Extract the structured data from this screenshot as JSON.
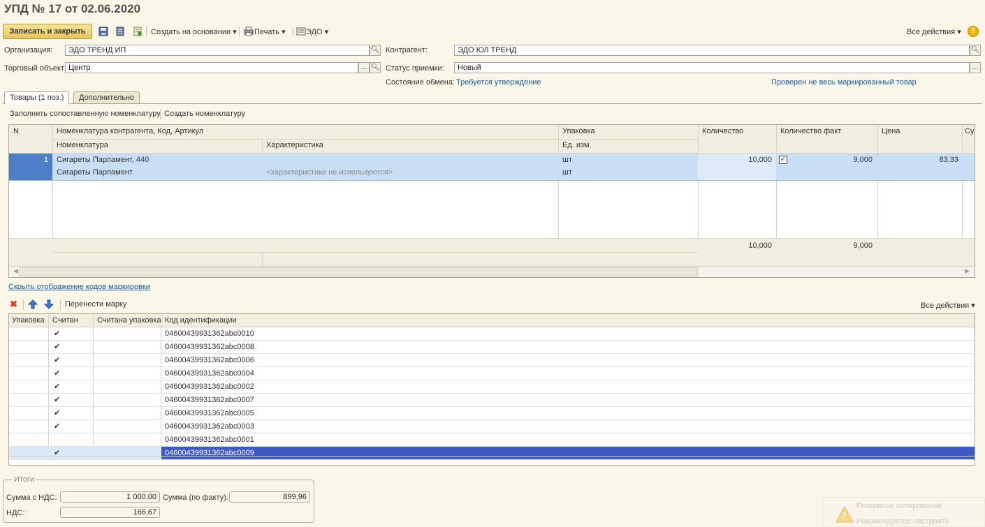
{
  "window": {
    "title": "УПД № 17 от 02.06.2020"
  },
  "toolbar": {
    "save_close_label": "Записать и закрыть",
    "create_based_label": "Создать на основании",
    "print_label": "Печать",
    "edo_label": "ЭДО",
    "all_actions_label": "Все действия",
    "help_label": "?"
  },
  "header": {
    "organization_label": "Организация:",
    "organization_value": "ЭДО ТРЕНД ИП",
    "counterparty_label": "Контрагент:",
    "counterparty_value": "ЭДО ЮЛ ТРЕНД",
    "store_label": "Торговый объект:",
    "store_value": "Центр",
    "accept_status_label": "Статус приемки:",
    "accept_status_value": "Новый",
    "exchange_state_label": "Состояние обмена:",
    "exchange_state_value": "Требуется утверждение",
    "marking_check_link": "Проверен не весь маркированный товар"
  },
  "tabs": [
    {
      "label": "Товары (1 поз.)",
      "active": true
    },
    {
      "label": "Дополнительно",
      "active": false
    }
  ],
  "goods_toolbar": {
    "fill_label": "Заполнить сопоставленную номенклатуру",
    "create_label": "Создать номенклатуру"
  },
  "goods_table": {
    "headers": {
      "n": "N",
      "nomen_counterparty": "Номенклатура контрагента, Код, Артикул",
      "nomen": "Номенклатура",
      "characteristic": "Характеристика",
      "package": "Упаковка",
      "unit": "Ед. изм.",
      "qty": "Количество",
      "qty_fact": "Количество факт",
      "price": "Цена",
      "sum": "Сум"
    },
    "row": {
      "n": "1",
      "nomen_counterparty": "Сигареты Парламент, 440",
      "nomen": "Сигареты Парламент",
      "characteristic": "<характеристики не используются>",
      "package": "шт",
      "unit": "шт",
      "qty": "10,000",
      "qty_fact_checked": true,
      "qty_fact": "9,000",
      "price": "83,33"
    },
    "footer": {
      "qty": "10,000",
      "qty_fact": "9,000"
    }
  },
  "marking": {
    "hide_link": "Скрыть отображение кодов маркировки",
    "move_label": "Перенести марку",
    "all_actions_label": "Все действия",
    "headers": {
      "package": "Упаковка",
      "scanned": "Считан",
      "scanned_package": "Считана упаковка",
      "code": "Код идентификации"
    },
    "rows": [
      {
        "scanned": "✔",
        "code": "04600439931362abc0010"
      },
      {
        "scanned": "✔",
        "code": "04600439931362abc0008"
      },
      {
        "scanned": "✔",
        "code": "04600439931362abc0006"
      },
      {
        "scanned": "✔",
        "code": "04600439931362abc0004"
      },
      {
        "scanned": "✔",
        "code": "04600439931362abc0002"
      },
      {
        "scanned": "✔",
        "code": "04600439931362abc0007"
      },
      {
        "scanned": "✔",
        "code": "04600439931362abc0005"
      },
      {
        "scanned": "✔",
        "code": "04600439931362abc0003"
      },
      {
        "scanned": "",
        "code": "04600439931362abc0001"
      },
      {
        "scanned": "✔",
        "code": "04600439931362abc0009"
      }
    ],
    "selected_index": 9
  },
  "totals": {
    "group_label": "Итоги",
    "sum_vat_label": "Сумма с НДС:",
    "sum_vat_value": "1 000,00",
    "sum_fact_label": "Сумма (по факту):",
    "sum_fact_value": "899,96",
    "vat_label": "НДС:",
    "vat_value": "166,67"
  },
  "notification": {
    "title": "Резервное копирование",
    "text": "Рекомендуется настроить"
  },
  "colors": {
    "accent_button": "#e9c65b",
    "selected_row": "#c5dcf5",
    "selected_mark_row": "#3f59c4",
    "link": "#1c58a6",
    "window_bg": "#fbf7e8"
  }
}
